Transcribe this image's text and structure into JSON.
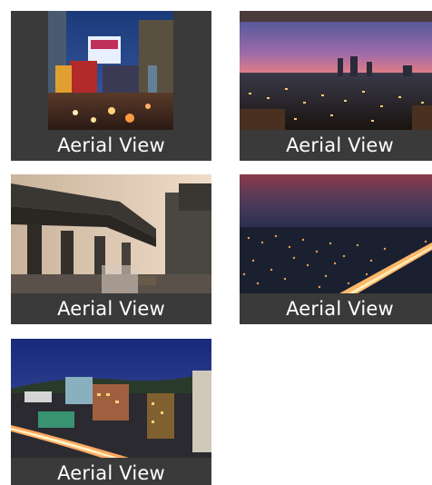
{
  "gallery": {
    "items": [
      {
        "caption": "Aerial View",
        "icon": "night-street-billboards-photo"
      },
      {
        "caption": "Aerial View",
        "icon": "dusk-city-skyline-photo"
      },
      {
        "caption": "Aerial View",
        "icon": "elevated-metro-bridge-photo"
      },
      {
        "caption": "Aerial View",
        "icon": "night-city-lights-aerial-photo"
      },
      {
        "caption": "Aerial View",
        "icon": "evening-city-traffic-trails-photo"
      }
    ]
  },
  "colors": {
    "caption_bg": "#3a3a3a",
    "caption_text": "#ffffff",
    "page_bg": "#ffffff"
  }
}
